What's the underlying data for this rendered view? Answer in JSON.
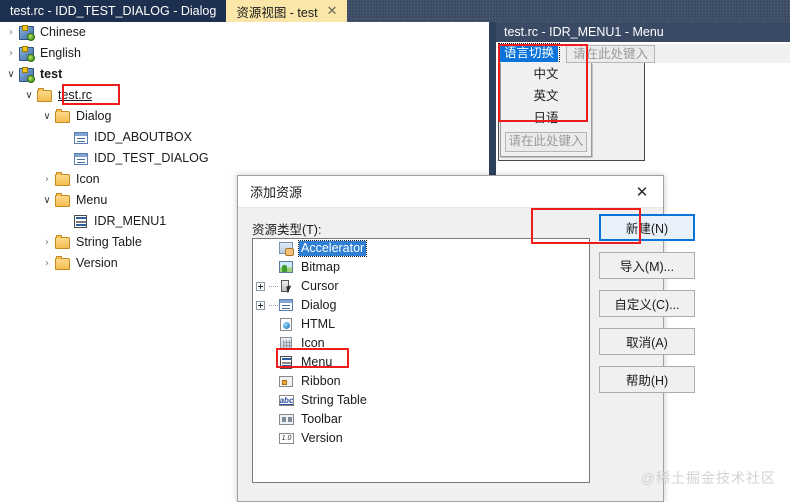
{
  "tabs": [
    {
      "label": "test.rc - IDD_TEST_DIALOG - Dialog",
      "active": false,
      "close": ""
    },
    {
      "label": "资源视图 - test",
      "active": true,
      "close": "✕"
    }
  ],
  "tree": {
    "items": [
      {
        "chevron": "›",
        "label": "Chinese",
        "icon": "rc-script-icon",
        "indent": 0,
        "bold": false
      },
      {
        "chevron": "›",
        "label": "English",
        "icon": "rc-script-icon",
        "indent": 0,
        "bold": false
      },
      {
        "chevron": "∨",
        "label": "test",
        "icon": "rc-script-icon",
        "indent": 0,
        "bold": true
      },
      {
        "chevron": "∨",
        "label": "test.rc",
        "icon": "folder-icon",
        "indent": 1,
        "bold": false
      },
      {
        "chevron": "∨",
        "label": "Dialog",
        "icon": "folder-icon",
        "indent": 2,
        "bold": false
      },
      {
        "chevron": "",
        "label": "IDD_ABOUTBOX",
        "icon": "dialog-resource-icon",
        "indent": 3,
        "bold": false
      },
      {
        "chevron": "",
        "label": "IDD_TEST_DIALOG",
        "icon": "dialog-resource-icon",
        "indent": 3,
        "bold": false
      },
      {
        "chevron": "›",
        "label": "Icon",
        "icon": "folder-icon",
        "indent": 2,
        "bold": false
      },
      {
        "chevron": "∨",
        "label": "Menu",
        "icon": "folder-icon",
        "indent": 2,
        "bold": false
      },
      {
        "chevron": "",
        "label": "IDR_MENU1",
        "icon": "menu-resource-icon",
        "indent": 3,
        "bold": false
      },
      {
        "chevron": "›",
        "label": "String Table",
        "icon": "folder-icon",
        "indent": 2,
        "bold": false
      },
      {
        "chevron": "›",
        "label": "Version",
        "icon": "folder-icon",
        "indent": 2,
        "bold": false
      }
    ]
  },
  "menu_editor": {
    "title": "test.rc - IDR_MENU1 - Menu",
    "root_item": "语言切换",
    "top_type_here": "请在此处键入",
    "items": [
      "中文",
      "英文",
      "日语"
    ],
    "sub_type_here": "请在此处键入"
  },
  "dialog": {
    "title": "添加资源",
    "close_icon": "✕",
    "list_label": "资源类型(T):",
    "list_label_accel": "T",
    "resources": [
      {
        "label": "Accelerator",
        "icon": "accelerator-icon",
        "expandable": false,
        "selected": true
      },
      {
        "label": "Bitmap",
        "icon": "bitmap-icon",
        "expandable": false,
        "selected": false
      },
      {
        "label": "Cursor",
        "icon": "cursor-icon",
        "expandable": true,
        "selected": false
      },
      {
        "label": "Dialog",
        "icon": "dialog-icon",
        "expandable": true,
        "selected": false
      },
      {
        "label": "HTML",
        "icon": "html-icon",
        "expandable": false,
        "selected": false
      },
      {
        "label": "Icon",
        "icon": "icon-icon",
        "expandable": false,
        "selected": false
      },
      {
        "label": "Menu",
        "icon": "menu-icon",
        "expandable": false,
        "selected": false
      },
      {
        "label": "Ribbon",
        "icon": "ribbon-icon",
        "expandable": false,
        "selected": false
      },
      {
        "label": "String Table",
        "icon": "string-table-icon",
        "expandable": false,
        "selected": false
      },
      {
        "label": "Toolbar",
        "icon": "toolbar-icon",
        "expandable": false,
        "selected": false
      },
      {
        "label": "Version",
        "icon": "version-icon",
        "expandable": false,
        "selected": false
      }
    ],
    "buttons": [
      {
        "text": "新建(N)",
        "pre": "新建(",
        "accel": "N",
        "post": ")",
        "primary": true
      },
      {
        "text": "导入(M)...",
        "pre": "导入(",
        "accel": "M",
        "post": ")...",
        "primary": false
      },
      {
        "text": "自定义(C)...",
        "pre": "自定义(",
        "accel": "C",
        "post": ")...",
        "primary": false
      },
      {
        "text": "取消(A)",
        "pre": "取消(",
        "accel": "A",
        "post": ")",
        "primary": false
      },
      {
        "text": "帮助(H)",
        "pre": "帮助(",
        "accel": "H",
        "post": ")",
        "primary": false
      }
    ]
  },
  "icon_glyphs": {
    "string_table": "abc",
    "version": "1.0"
  },
  "watermark": "@稀土掘金技术社区",
  "colors": {
    "tab_active_bg": "#fae6a8",
    "tab_inactive_bg": "#1e3050",
    "chrome_bg": "#3b4a64",
    "selection_blue": "#2f7fd4",
    "annotation_red": "#ee1d1d",
    "primary_border": "#0a74da"
  }
}
